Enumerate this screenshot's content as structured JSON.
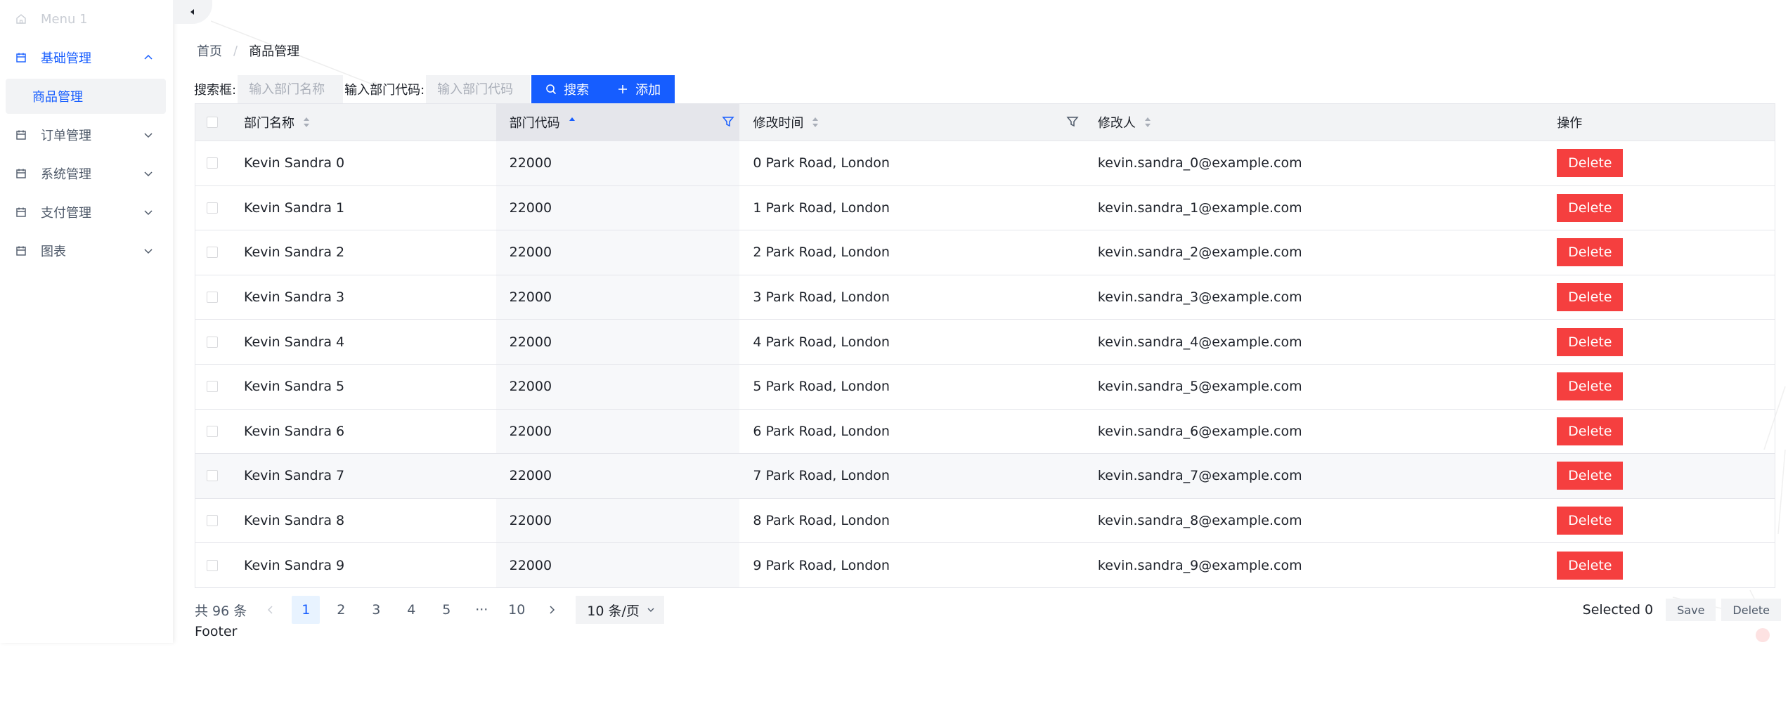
{
  "sidebar": {
    "items": [
      {
        "label": "Menu 1",
        "icon": "home-icon"
      },
      {
        "label": "基础管理",
        "icon": "calendar-icon"
      },
      {
        "label": "订单管理",
        "icon": "calendar-icon"
      },
      {
        "label": "系统管理",
        "icon": "calendar-icon"
      },
      {
        "label": "支付管理",
        "icon": "calendar-icon"
      },
      {
        "label": "图表",
        "icon": "calendar-icon"
      }
    ],
    "subitem": "商品管理"
  },
  "breadcrumb": {
    "home": "首页",
    "separator": "/",
    "current": "商品管理"
  },
  "search": {
    "label1": "搜索框:",
    "placeholder1": "输入部门名称",
    "label2": "输入部门代码:",
    "placeholder2": "输入部门代码",
    "search_btn": "搜索",
    "add_btn": "添加"
  },
  "table": {
    "headers": {
      "name": "部门名称",
      "code": "部门代码",
      "time": "修改时间",
      "person": "修改人",
      "op": "操作"
    },
    "rows": [
      {
        "name": "Kevin Sandra 0",
        "code": "22000",
        "time": "0 Park Road, London",
        "person": "kevin.sandra_0@example.com",
        "op": "Delete"
      },
      {
        "name": "Kevin Sandra 1",
        "code": "22000",
        "time": "1 Park Road, London",
        "person": "kevin.sandra_1@example.com",
        "op": "Delete"
      },
      {
        "name": "Kevin Sandra 2",
        "code": "22000",
        "time": "2 Park Road, London",
        "person": "kevin.sandra_2@example.com",
        "op": "Delete"
      },
      {
        "name": "Kevin Sandra 3",
        "code": "22000",
        "time": "3 Park Road, London",
        "person": "kevin.sandra_3@example.com",
        "op": "Delete"
      },
      {
        "name": "Kevin Sandra 4",
        "code": "22000",
        "time": "4 Park Road, London",
        "person": "kevin.sandra_4@example.com",
        "op": "Delete"
      },
      {
        "name": "Kevin Sandra 5",
        "code": "22000",
        "time": "5 Park Road, London",
        "person": "kevin.sandra_5@example.com",
        "op": "Delete"
      },
      {
        "name": "Kevin Sandra 6",
        "code": "22000",
        "time": "6 Park Road, London",
        "person": "kevin.sandra_6@example.com",
        "op": "Delete"
      },
      {
        "name": "Kevin Sandra 7",
        "code": "22000",
        "time": "7 Park Road, London",
        "person": "kevin.sandra_7@example.com",
        "op": "Delete"
      },
      {
        "name": "Kevin Sandra 8",
        "code": "22000",
        "time": "8 Park Road, London",
        "person": "kevin.sandra_8@example.com",
        "op": "Delete"
      },
      {
        "name": "Kevin Sandra 9",
        "code": "22000",
        "time": "9 Park Road, London",
        "person": "kevin.sandra_9@example.com",
        "op": "Delete"
      }
    ]
  },
  "pagination": {
    "total": "共 96 条",
    "pages": [
      "1",
      "2",
      "3",
      "4",
      "5",
      "···",
      "10"
    ],
    "current": "1",
    "page_size": "10 条/页"
  },
  "footer": "Footer",
  "selection": {
    "text": "Selected 0",
    "save": "Save",
    "delete": "Delete"
  },
  "colors": {
    "primary": "#165dff",
    "danger": "#f53f3f",
    "header_bg": "#f2f3f5"
  }
}
